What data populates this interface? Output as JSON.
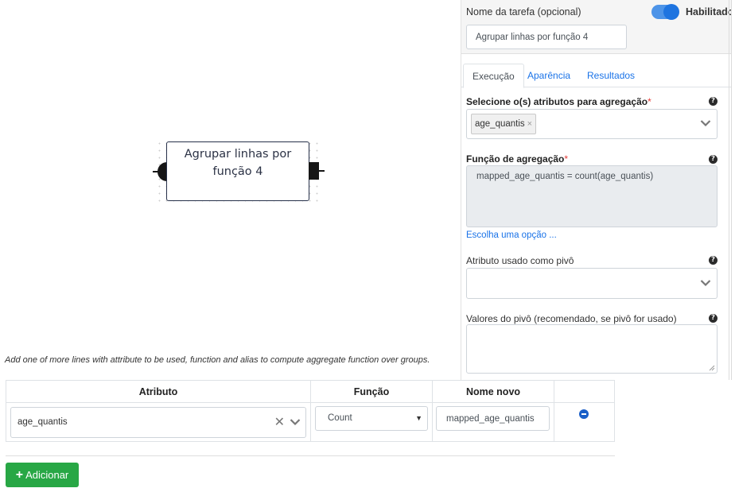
{
  "canvas": {
    "node_title": "Agrupar linhas por função 4"
  },
  "panel": {
    "task_name_label": "Nome da tarefa (opcional)",
    "task_name_value": "Agrupar linhas por função 4",
    "enabled_label": "Habilitado",
    "enabled": true,
    "tabs": [
      {
        "label": "Execução",
        "active": true
      },
      {
        "label": "Aparência",
        "active": false
      },
      {
        "label": "Resultados",
        "active": false
      }
    ],
    "attributes_label": "Selecione o(s) atributos para agregação",
    "attributes_selected": [
      "age_quantis"
    ],
    "required_mark": "*",
    "agg_function_label": "Função de agregação",
    "agg_function_value": "mapped_age_quantis = count(age_quantis)",
    "choose_option_link": "Escolha uma opção ...",
    "pivot_label": "Atributo usado como pivô",
    "pivot_value": "",
    "pivot_values_label": "Valores do pivô (recomendado, se pivô for usado)",
    "pivot_values_value": "",
    "help_glyph": "?"
  },
  "editor": {
    "hint": "Add one of more lines with attribute to be used, function and alias to compute aggregate function over groups.",
    "columns": [
      "Atributo",
      "Função",
      "Nome novo"
    ],
    "rows": [
      {
        "attribute": "age_quantis",
        "function": "Count",
        "alias": "mapped_age_quantis"
      }
    ],
    "clear_glyph": "✕",
    "caret_glyph": "▼",
    "add_button_plus": "+",
    "add_button_label": "Adicionar"
  },
  "colors": {
    "accent": "#1a73e8",
    "toggle": "#1e74e0",
    "add_button": "#28a745",
    "required": "#e53935"
  }
}
